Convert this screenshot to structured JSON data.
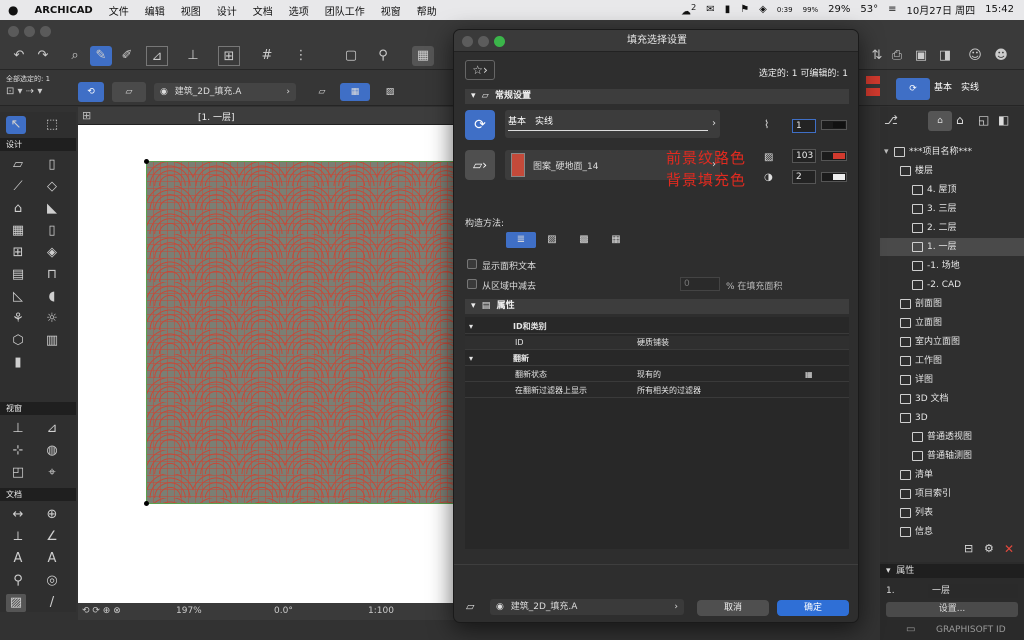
{
  "menubar": {
    "app": "ARCHICAD",
    "items": [
      "文件",
      "编辑",
      "视图",
      "设计",
      "文档",
      "选项",
      "团队工作",
      "视窗",
      "帮助"
    ],
    "status": {
      "battery_time": "0:39",
      "battery_pct": "99%",
      "cpu": "29%",
      "temp": "53°",
      "date": "10月27日 周四",
      "time": "15:42",
      "badge": "2"
    }
  },
  "toolbar": {
    "selection_count_label": "全部选定的: 1",
    "layer_name": "建筑_2D_填充.A"
  },
  "toolbox": {
    "sections": [
      "设计",
      "视窗",
      "文档"
    ]
  },
  "canvas": {
    "tab_label": "[1. 一层]",
    "status": {
      "zoom": "197%",
      "angle": "0.0°",
      "scale": "1:100"
    }
  },
  "navigator": {
    "project": "***项目名称***",
    "items": [
      {
        "label": "楼层",
        "indent": 1
      },
      {
        "label": "4. 屋顶",
        "indent": 2
      },
      {
        "label": "3. 三层",
        "indent": 2
      },
      {
        "label": "2. 二层",
        "indent": 2
      },
      {
        "label": "1. 一层",
        "indent": 2,
        "selected": true
      },
      {
        "label": "-1. 场地",
        "indent": 2
      },
      {
        "label": "-2. CAD",
        "indent": 2
      },
      {
        "label": "剖面图",
        "indent": 1
      },
      {
        "label": "立面图",
        "indent": 1
      },
      {
        "label": "室内立面图",
        "indent": 1
      },
      {
        "label": "工作图",
        "indent": 1
      },
      {
        "label": "详图",
        "indent": 1
      },
      {
        "label": "3D 文档",
        "indent": 1
      },
      {
        "label": "3D",
        "indent": 1
      },
      {
        "label": "普通透视图",
        "indent": 2
      },
      {
        "label": "普通轴测图",
        "indent": 2
      },
      {
        "label": "清单",
        "indent": 1
      },
      {
        "label": "项目索引",
        "indent": 1
      },
      {
        "label": "列表",
        "indent": 1
      },
      {
        "label": "信息",
        "indent": 1
      }
    ],
    "properties": {
      "header": "属性",
      "story_label": "1.",
      "story_value": "一层",
      "settings_btn": "设置..."
    },
    "brand": "GRAPHISOFT ID"
  },
  "dialog": {
    "title": "填充选择设置",
    "selection_info": "选定的: 1 可编辑的: 1",
    "general_header": "常规设置",
    "line_type": "基本　实线",
    "line_pen": "1",
    "fill_name": "图案_硬地面_14",
    "fg_pen": "103",
    "bg_pen": "2",
    "annotation_fg": "前景纹路色",
    "annotation_bg": "背景填充色",
    "construction_label": "构造方法:",
    "show_area_label": "显示面积文本",
    "subtract_label": "从区域中减去",
    "subtract_value": "0",
    "subtract_unit": "% 在填充面积",
    "attributes_header": "属性",
    "id_category_header": "ID和类别",
    "rows": [
      {
        "k": "ID",
        "v": "硬质铺装"
      }
    ],
    "renovation_header": "翻新",
    "renovation_rows": [
      {
        "k": "翻新状态",
        "v": "现有的"
      },
      {
        "k": "在翻新过滤器上显示",
        "v": "所有相关的过滤器"
      }
    ],
    "footer_layer": "建筑_2D_填充.A",
    "cancel_label": "取消",
    "ok_label": "确定"
  },
  "colors": {
    "accent": "#2f6fd6",
    "pen_red": "#d23a2e",
    "annotation": "#e02a1f"
  }
}
